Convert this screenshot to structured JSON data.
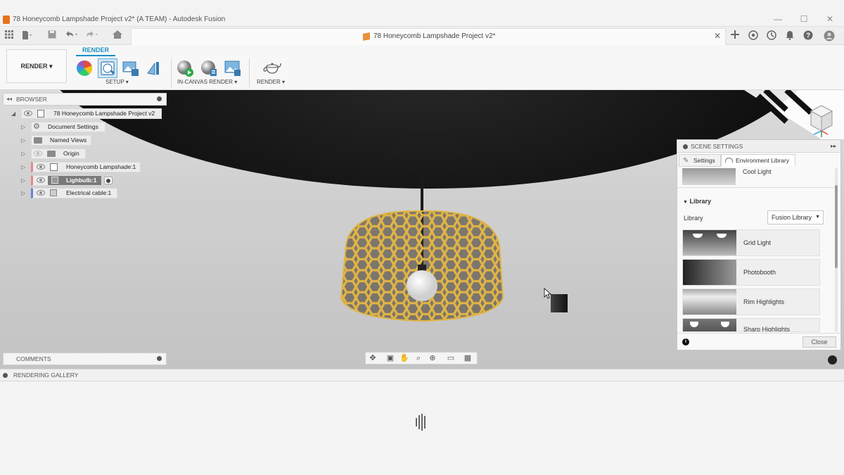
{
  "titlebar": {
    "title": "78 Honeycomb Lampshade Project v2* (A TEAM) - Autodesk Fusion",
    "minimize": "—",
    "maximize": "☐",
    "close": "✕"
  },
  "document_tab": {
    "label": "78 Honeycomb Lampshade Project v2*"
  },
  "ribbon": {
    "workspace": "RENDER ▾",
    "active_tab": "RENDER",
    "groups": {
      "setup": "SETUP ▾",
      "in_canvas": "IN-CANVAS RENDER ▾",
      "render": "RENDER ▾"
    }
  },
  "browser": {
    "title": "BROWSER",
    "items": [
      {
        "label": "78 Honeycomb Lampshade Project v2"
      },
      {
        "label": "Document Settings"
      },
      {
        "label": "Named Views"
      },
      {
        "label": "Origin"
      },
      {
        "label": "Honeycomb Lampshade:1"
      },
      {
        "label": "Lighbulb:1"
      },
      {
        "label": "Electrical cable:1"
      }
    ]
  },
  "comments": {
    "title": "COMMENTS"
  },
  "scene_settings": {
    "title": "SCENE SETTINGS",
    "tabs": [
      "Settings",
      "Environment Library"
    ],
    "current_env": "Cool Light",
    "library_section": "Library",
    "library_label": "Library",
    "library_select": "Fusion Library",
    "environments": [
      {
        "name": "Grid Light"
      },
      {
        "name": "Photobooth"
      },
      {
        "name": "Rim Highlights"
      },
      {
        "name": "Sharp Highlights"
      }
    ],
    "close_button": "Close"
  },
  "gallery": {
    "title": "RENDERING GALLERY"
  },
  "colors": {
    "accent": "#1a8fc6",
    "lampshade": "#e0b445",
    "component_bar": "#e08a8a",
    "cable_bar": "#5a8ad6"
  }
}
